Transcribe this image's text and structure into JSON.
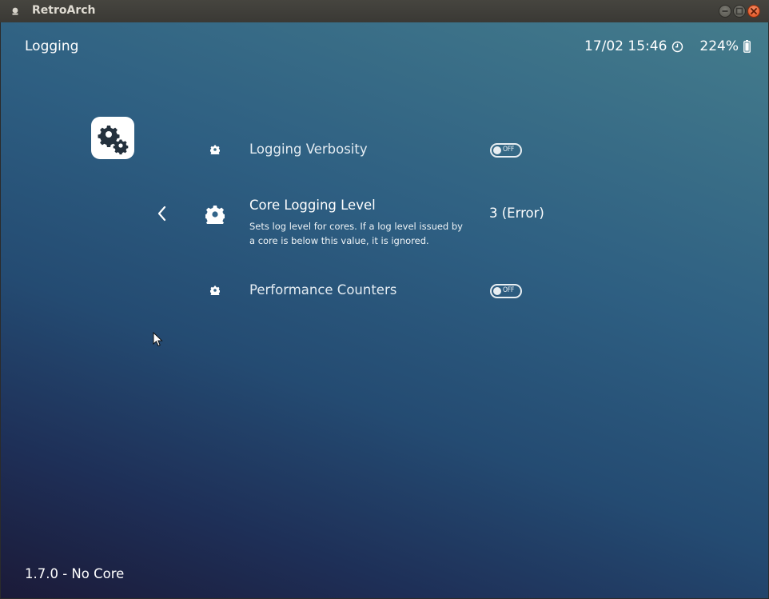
{
  "window": {
    "title": "RetroArch",
    "controls": [
      "minimize",
      "maximize",
      "close"
    ]
  },
  "header": {
    "title": "Logging",
    "datetime": "17/02 15:46",
    "clock_icon": "clock-icon",
    "battery": "224%",
    "battery_icon": "battery-icon"
  },
  "menu": {
    "category_icon": "settings-gears-icon",
    "back_icon": "chevron-left-icon",
    "items": [
      {
        "label": "Logging Verbosity",
        "icon": "gear-icon",
        "value_type": "toggle",
        "toggle_text": "OFF",
        "selected": false
      },
      {
        "label": "Core Logging Level",
        "icon": "gear-icon",
        "value": "3 (Error)",
        "description": "Sets log level for cores. If a log level issued by a core is below this value, it is ignored.",
        "description_line1": "Sets log level for cores. If a log level issued by",
        "description_line2": "a core is below this value, it is ignored.",
        "selected": true
      },
      {
        "label": "Performance Counters",
        "icon": "gear-icon",
        "value_type": "toggle",
        "toggle_text": "OFF",
        "selected": false
      }
    ]
  },
  "footer": {
    "version": "1.7.0 - No Core"
  },
  "colors": {
    "titlebar": "#3f3e39",
    "close_button": "#e8551f",
    "background_top": "#447c8c",
    "background_bottom": "#1b1a38",
    "text": "#ffffff"
  }
}
